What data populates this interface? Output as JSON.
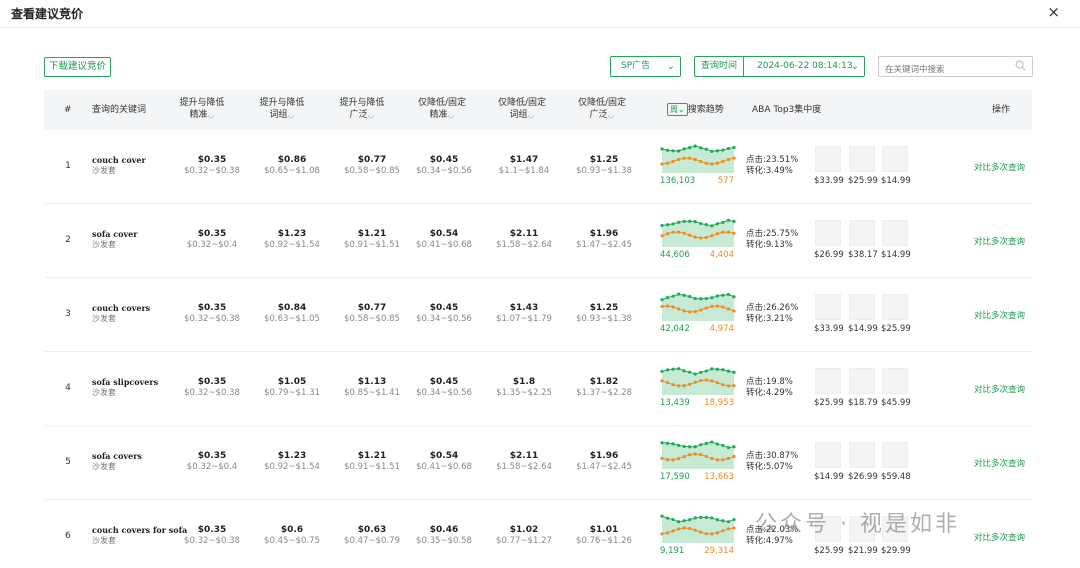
{
  "modal": {
    "title": "查看建议竞价",
    "close": "×"
  },
  "toolbar": {
    "download": "下载建议竞价",
    "ad_type": "SP广告",
    "time_label": "查询时间",
    "time_value": "2024-06-22 08:14:13",
    "search_placeholder": "在关键词中搜索"
  },
  "columns": {
    "index": "#",
    "keyword": "查询的关键词",
    "c1a": "提升与降低",
    "c1b": "精准",
    "c2a": "提升与降低",
    "c2b": "词组",
    "c3a": "提升与降低",
    "c3b": "广泛",
    "c4a": "仅降低/固定",
    "c4b": "精准",
    "c5a": "仅降低/固定",
    "c5b": "词组",
    "c6a": "仅降低/固定",
    "c6b": "广泛",
    "trend_toggle": "周",
    "trend": "搜索趋势",
    "aba": "ABA Top3集中度",
    "action": "操作"
  },
  "colors": {
    "accent": "#1f9b50",
    "green_line": "#1faa59",
    "orange_line": "#f08a24"
  },
  "rows": [
    {
      "index": "1",
      "keyword": "couch cover",
      "sub": "沙发套",
      "bids": [
        {
          "v": "$0.35",
          "r": "$0.32~$0.38"
        },
        {
          "v": "$0.86",
          "r": "$0.65~$1.08"
        },
        {
          "v": "$0.77",
          "r": "$0.58~$0.85"
        },
        {
          "v": "$0.45",
          "r": "$0.34~$0.56"
        },
        {
          "v": "$1.47",
          "r": "$1.1~$1.84"
        },
        {
          "v": "$1.25",
          "r": "$0.93~$1.38"
        }
      ],
      "trend_left": "136,103",
      "trend_right": "577",
      "click": "点击:23.51%",
      "conv": "转化:3.49%",
      "prices": [
        "$33.99",
        "$25.99",
        "$14.99"
      ],
      "action": "对比多次查询"
    },
    {
      "index": "2",
      "keyword": "sofa cover",
      "sub": "沙发套",
      "bids": [
        {
          "v": "$0.35",
          "r": "$0.32~$0.4"
        },
        {
          "v": "$1.23",
          "r": "$0.92~$1.54"
        },
        {
          "v": "$1.21",
          "r": "$0.91~$1.51"
        },
        {
          "v": "$0.54",
          "r": "$0.41~$0.68"
        },
        {
          "v": "$2.11",
          "r": "$1.58~$2.64"
        },
        {
          "v": "$1.96",
          "r": "$1.47~$2.45"
        }
      ],
      "trend_left": "44,606",
      "trend_right": "4,404",
      "click": "点击:25.75%",
      "conv": "转化:9.13%",
      "prices": [
        "$26.99",
        "$38.17",
        "$14.99"
      ],
      "action": "对比多次查询"
    },
    {
      "index": "3",
      "keyword": "couch covers",
      "sub": "沙发套",
      "bids": [
        {
          "v": "$0.35",
          "r": "$0.32~$0.38"
        },
        {
          "v": "$0.84",
          "r": "$0.63~$1.05"
        },
        {
          "v": "$0.77",
          "r": "$0.58~$0.85"
        },
        {
          "v": "$0.45",
          "r": "$0.34~$0.56"
        },
        {
          "v": "$1.43",
          "r": "$1.07~$1.79"
        },
        {
          "v": "$1.25",
          "r": "$0.93~$1.38"
        }
      ],
      "trend_left": "42,042",
      "trend_right": "4,974",
      "click": "点击:26.26%",
      "conv": "转化:3.21%",
      "prices": [
        "$33.99",
        "$14.99",
        "$25.99"
      ],
      "action": "对比多次查询"
    },
    {
      "index": "4",
      "keyword": "sofa slipcovers",
      "sub": "沙发套",
      "bids": [
        {
          "v": "$0.35",
          "r": "$0.32~$0.38"
        },
        {
          "v": "$1.05",
          "r": "$0.79~$1.31"
        },
        {
          "v": "$1.13",
          "r": "$0.85~$1.41"
        },
        {
          "v": "$0.45",
          "r": "$0.34~$0.56"
        },
        {
          "v": "$1.8",
          "r": "$1.35~$2.25"
        },
        {
          "v": "$1.82",
          "r": "$1.37~$2.28"
        }
      ],
      "trend_left": "13,439",
      "trend_right": "18,953",
      "click": "点击:19.8%",
      "conv": "转化:4.29%",
      "prices": [
        "$25.99",
        "$18.79",
        "$45.99"
      ],
      "action": "对比多次查询"
    },
    {
      "index": "5",
      "keyword": "sofa covers",
      "sub": "沙发套",
      "bids": [
        {
          "v": "$0.35",
          "r": "$0.32~$0.4"
        },
        {
          "v": "$1.23",
          "r": "$0.92~$1.54"
        },
        {
          "v": "$1.21",
          "r": "$0.91~$1.51"
        },
        {
          "v": "$0.54",
          "r": "$0.41~$0.68"
        },
        {
          "v": "$2.11",
          "r": "$1.58~$2.64"
        },
        {
          "v": "$1.96",
          "r": "$1.47~$2.45"
        }
      ],
      "trend_left": "17,590",
      "trend_right": "13,663",
      "click": "点击:30.87%",
      "conv": "转化:5.07%",
      "prices": [
        "$14.99",
        "$26.99",
        "$59.48"
      ],
      "action": "对比多次查询"
    },
    {
      "index": "6",
      "keyword": "couch covers for sofa",
      "sub": "沙发套",
      "bids": [
        {
          "v": "$0.35",
          "r": "$0.32~$0.38"
        },
        {
          "v": "$0.6",
          "r": "$0.45~$0.75"
        },
        {
          "v": "$0.63",
          "r": "$0.47~$0.79"
        },
        {
          "v": "$0.46",
          "r": "$0.35~$0.58"
        },
        {
          "v": "$1.02",
          "r": "$0.77~$1.27"
        },
        {
          "v": "$1.01",
          "r": "$0.76~$1.26"
        }
      ],
      "trend_left": "9,191",
      "trend_right": "29,314",
      "click": "点击:22.03%",
      "conv": "转化:4.97%",
      "prices": [
        "$25.99",
        "$21.99",
        "$29.99"
      ],
      "action": "对比多次查询"
    }
  ],
  "watermark": "公众号 · 视是如非"
}
